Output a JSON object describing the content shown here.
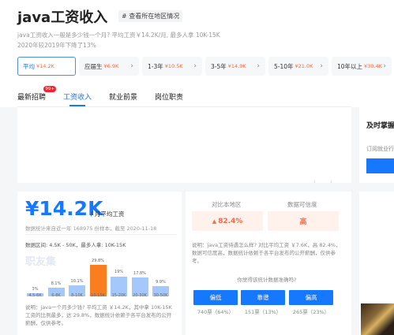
{
  "header": {
    "title": "java工资收入",
    "region_tag": "# 查看所在地区情况",
    "summary_line1": "java工资收入一般是多少钱一个月? 平均工资￥14.2K/月, 最多人拿 10K-15K",
    "summary_line2": "2020年较2019年下降了13%"
  },
  "filters": [
    {
      "label": "平均",
      "value": "¥14.2K",
      "active": true
    },
    {
      "label": "应届生",
      "value": "¥6.9K"
    },
    {
      "label": "1-3年",
      "value": "¥10.5K"
    },
    {
      "label": "3-5年",
      "value": "¥14.9K"
    },
    {
      "label": "5-10年",
      "value": "¥21.0K"
    },
    {
      "label": "10年以上",
      "value": "¥30.4K"
    }
  ],
  "tabs": [
    {
      "label": "最新招聘",
      "badge": "99+"
    },
    {
      "label": "工资收入",
      "active": true
    },
    {
      "label": "就业前景"
    },
    {
      "label": "岗位职责"
    }
  ],
  "salary": {
    "amount": "¥14.2K",
    "unit": "/ 月平均工资",
    "source": "数据统计来自近一年 168975 份样本，截至 2020-11-18",
    "range": "数据区间: 4.5K - 50K，最多人拿: 10K-15K",
    "watermark": "职友集",
    "note": "说明：java一个月多少钱? 平均工资 ￥14.2K，其中拿 10K-15K 工资的比例最多，达 29.8%，数据统计依赖于各平台发布的公开薪酬，仅供参考。"
  },
  "chart_data": {
    "type": "bar",
    "categories": [
      "4.5-6K",
      "6-8K",
      "8-10K",
      "10-15K",
      "15-20K",
      "20-30K",
      "30-50K"
    ],
    "values": [
      3,
      8.1,
      10.1,
      29.8,
      19,
      17.8,
      9.9
    ],
    "value_labels": [
      "3%",
      "8.1%",
      "10.1%",
      "29.8%",
      "19%",
      "17.8%",
      "9.9%"
    ],
    "highlight_index": 3,
    "colors": {
      "bar": "#a4c8fb",
      "highlight": "#fa7d1f"
    }
  },
  "compare": {
    "head_left": "对比本地区",
    "head_right": "数据可信度",
    "value_left": "82.4%",
    "value_right": "高",
    "note": "说明：java工资待遇怎么样? 对比平均工资 ￥7.6K，高 82.4%，数据可信度高，数据统计依赖于各平台发布的公开薪酬，仅供参考。",
    "question": "你觉得该统计数据准确吗?",
    "votes": [
      {
        "label": "偏低",
        "count": "740票（64%）"
      },
      {
        "label": "靠谱",
        "count": "151票（13%）"
      },
      {
        "label": "偏高",
        "count": "265票（23%）"
      }
    ]
  },
  "right_panel": {
    "title": "及时掌握",
    "subtitle": "订阅就业行"
  },
  "colors": {
    "accent": "#1677ff",
    "orange": "#fa6a43"
  }
}
